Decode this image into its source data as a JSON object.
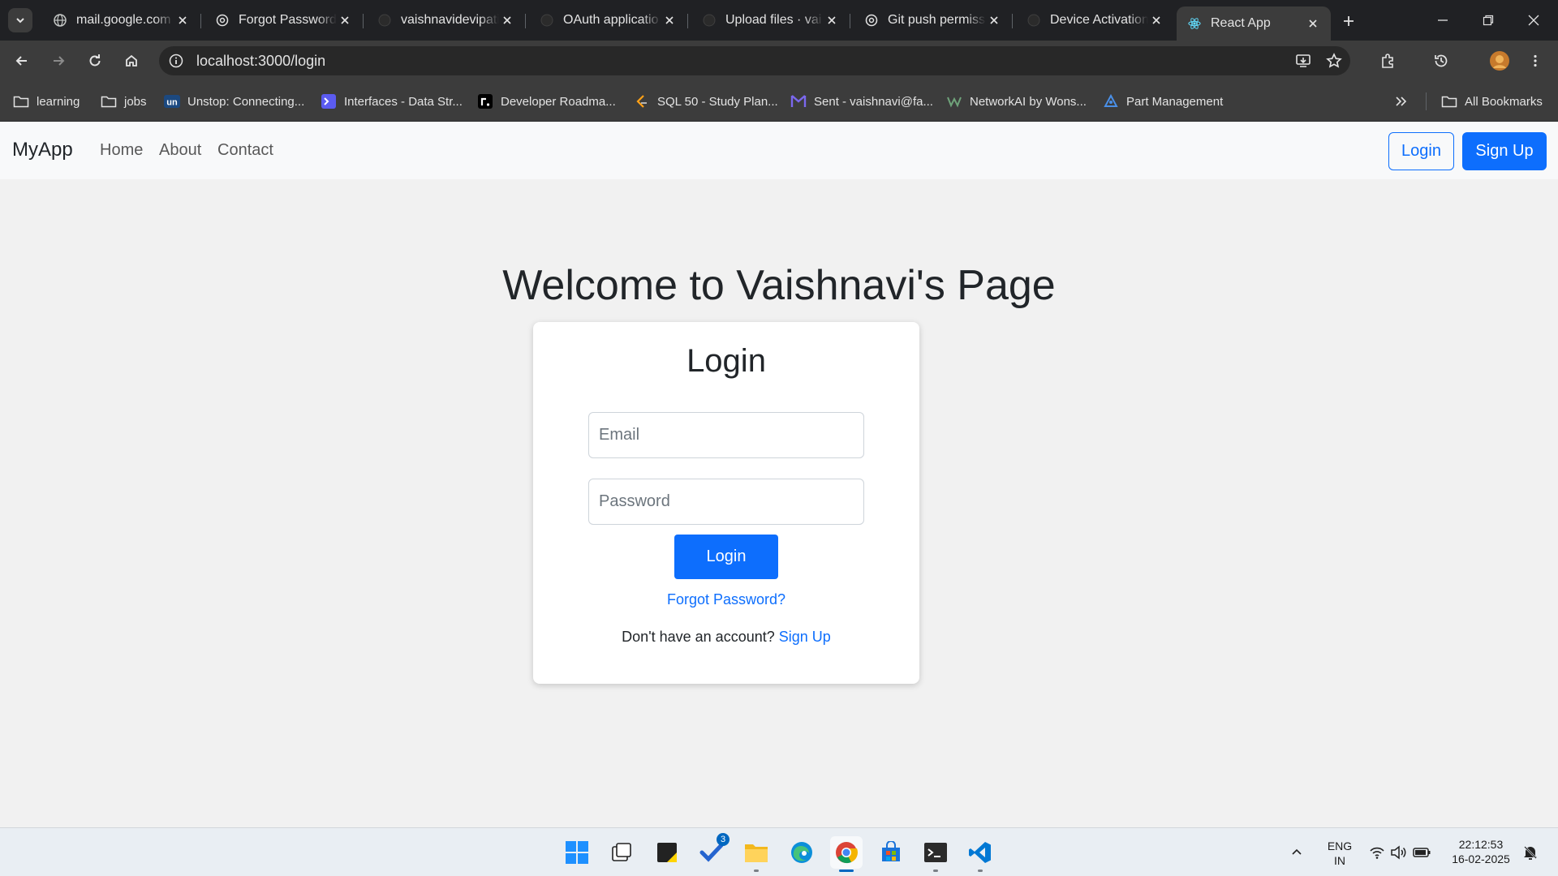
{
  "browser": {
    "tabs": [
      {
        "title": "mail.google.com",
        "icon": "globe-icon"
      },
      {
        "title": "Forgot Password",
        "icon": "openai-icon"
      },
      {
        "title": "vaishnavidevipati",
        "icon": "github-icon"
      },
      {
        "title": "OAuth applicatio",
        "icon": "github-icon"
      },
      {
        "title": "Upload files · vai",
        "icon": "github-icon"
      },
      {
        "title": "Git push permiss",
        "icon": "openai-icon"
      },
      {
        "title": "Device Activation",
        "icon": "github-icon"
      },
      {
        "title": "React App",
        "icon": "react-icon",
        "active": true
      }
    ],
    "url": "localhost:3000/login",
    "bookmarks": [
      {
        "label": "learning",
        "icon": "folder-icon"
      },
      {
        "label": "jobs",
        "icon": "folder-icon"
      },
      {
        "label": "Unstop: Connecting...",
        "icon": "unstop-icon"
      },
      {
        "label": "Interfaces - Data Str...",
        "icon": "terminal-icon"
      },
      {
        "label": "Developer Roadma...",
        "icon": "roadmap-icon"
      },
      {
        "label": "SQL 50 - Study Plan...",
        "icon": "leetcode-icon"
      },
      {
        "label": "Sent - vaishnavi@fa...",
        "icon": "mail-icon"
      },
      {
        "label": "NetworkAI by Wons...",
        "icon": "networkai-icon"
      },
      {
        "label": "Part Management",
        "icon": "part-icon"
      }
    ],
    "all_bookmarks": "All Bookmarks"
  },
  "navbar": {
    "brand": "MyApp",
    "links": [
      "Home",
      "About",
      "Contact"
    ],
    "login": "Login",
    "signup": "Sign Up"
  },
  "page": {
    "welcome": "Welcome to Vaishnavi's Page",
    "card_title": "Login",
    "email_placeholder": "Email",
    "password_placeholder": "Password",
    "login_button": "Login",
    "forgot": "Forgot Password?",
    "no_account": "Don't have an account?",
    "signup_link": "Sign Up"
  },
  "taskbar": {
    "todo_badge": "3",
    "lang_top": "ENG",
    "lang_bottom": "IN",
    "time": "22:12:53",
    "date": "16-02-2025"
  },
  "colors": {
    "primary": "#0d6efd",
    "chrome_dark": "#202124",
    "chrome_toolbar": "#3c3c3c",
    "page_bg": "#f1f1f1",
    "navbar_bg": "#f8f9fa"
  }
}
